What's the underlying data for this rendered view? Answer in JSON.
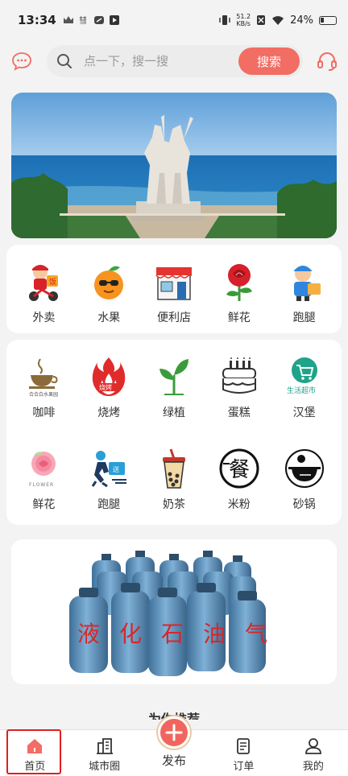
{
  "status_bar": {
    "time": "13:34",
    "net_speed_value": "51.2",
    "net_speed_unit": "KB/s",
    "battery": "24%"
  },
  "search": {
    "placeholder": "点一下，搜一搜",
    "button_label": "搜索"
  },
  "categories_row1": [
    {
      "label": "外卖",
      "icon": "delivery-boy-icon"
    },
    {
      "label": "水果",
      "icon": "orange-fruit-icon"
    },
    {
      "label": "便利店",
      "icon": "store-icon"
    },
    {
      "label": "鲜花",
      "icon": "rose-icon"
    },
    {
      "label": "跑腿",
      "icon": "courier-icon"
    }
  ],
  "categories_row2": [
    {
      "label": "咖啡",
      "icon": "coffee-icon",
      "sub": "合合白水果园"
    },
    {
      "label": "烧烤",
      "icon": "bbq-flame-icon",
      "sub": "烧烤"
    },
    {
      "label": "绿植",
      "icon": "plant-icon"
    },
    {
      "label": "蛋糕",
      "icon": "cake-icon"
    },
    {
      "label": "汉堡",
      "icon": "supermarket-cart-icon",
      "sub": "生活超市"
    }
  ],
  "categories_row3": [
    {
      "label": "鲜花",
      "icon": "flower-icon",
      "sub": "FLOWER"
    },
    {
      "label": "跑腿",
      "icon": "runner-icon",
      "sub": "送"
    },
    {
      "label": "奶茶",
      "icon": "milk-tea-icon"
    },
    {
      "label": "米粉",
      "icon": "rice-noodle-icon",
      "sub": "餐"
    },
    {
      "label": "砂锅",
      "icon": "clay-pot-icon"
    }
  ],
  "promo_banner": {
    "title_chars": [
      "液",
      "化",
      "石",
      "油",
      "气"
    ]
  },
  "section_peek": "为你推荐",
  "tabbar": {
    "home": "首页",
    "city_circle": "城市圈",
    "publish": "发布",
    "orders": "订单",
    "mine": "我的"
  },
  "colors": {
    "accent": "#f26d63",
    "highlight_box": "#e01e1e"
  }
}
